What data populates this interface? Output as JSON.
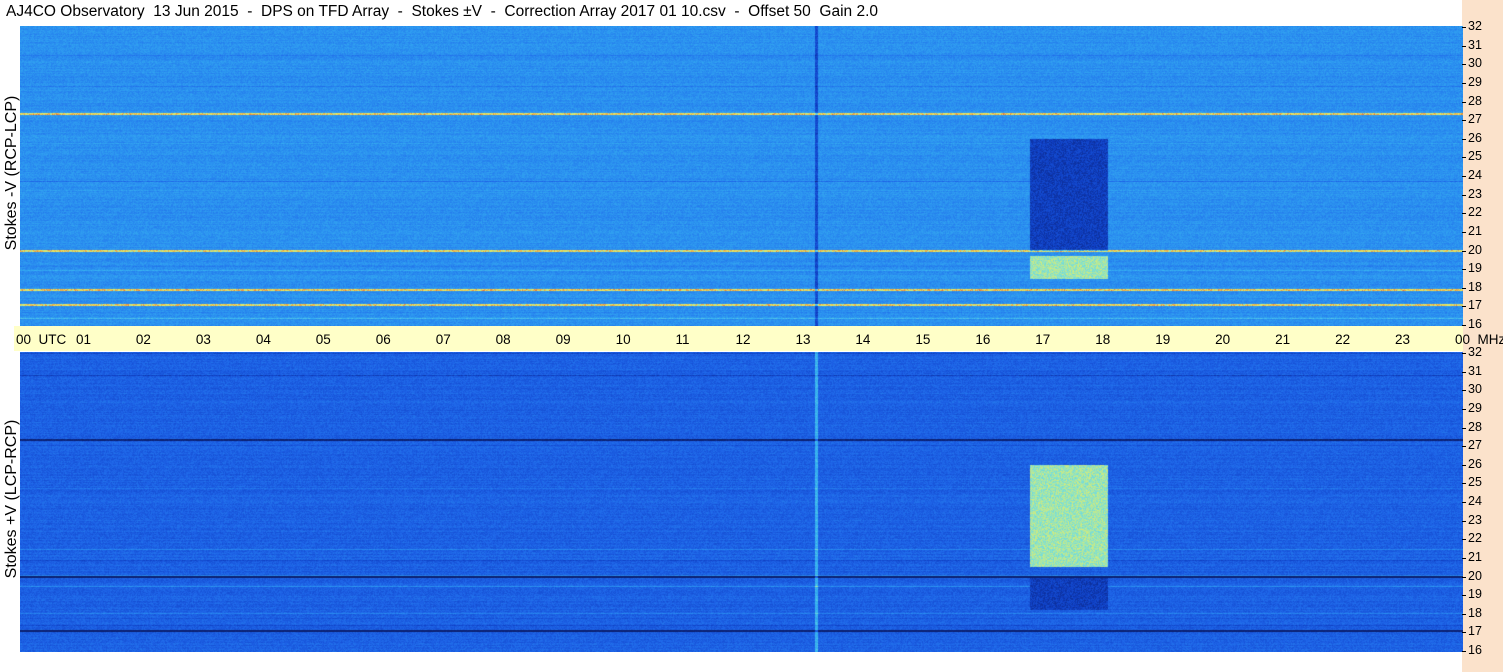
{
  "title": "AJ4CO Observatory  13 Jun 2015  -  DPS on TFD Array  -  Stokes ±V  -  Correction Array 2017 01 10.csv  -  Offset 50  Gain 2.0",
  "colors": {
    "timebar_bg": "#ffffc8",
    "right_strip_bg": "#fbe2cb",
    "colormap": [
      "#0b1f6e",
      "#0f3fc4",
      "#1e64e8",
      "#2a8ff0",
      "#39b7f0",
      "#7ee0d4",
      "#f2f05a",
      "#f59a3a",
      "#d83a2a"
    ]
  },
  "chart_data": [
    {
      "type": "heatmap",
      "panel": "top",
      "ylabel": "Stokes -V (RCP-LCP)",
      "x_unit": "UTC",
      "y_unit": "MHz",
      "xlim": [
        0,
        24
      ],
      "ylim": [
        16,
        32
      ],
      "x_ticks": [
        "00",
        "01",
        "02",
        "03",
        "04",
        "05",
        "06",
        "07",
        "08",
        "09",
        "10",
        "11",
        "12",
        "13",
        "14",
        "15",
        "16",
        "17",
        "18",
        "19",
        "20",
        "21",
        "22",
        "23",
        "00"
      ],
      "y_ticks": [
        "16",
        "17",
        "18",
        "19",
        "20",
        "21",
        "22",
        "23",
        "24",
        "25",
        "26",
        "27",
        "28",
        "29",
        "30",
        "31",
        "32"
      ],
      "features": [
        {
          "kind": "bright_band",
          "t_start": 16.8,
          "t_end": 18.1,
          "f_low": 18.5,
          "f_high": 19.7
        },
        {
          "kind": "dark_band",
          "t_start": 16.8,
          "t_end": 18.1,
          "f_low": 20.0,
          "f_high": 26.0
        },
        {
          "kind": "dark_vertical_line",
          "t": 13.25
        },
        {
          "kind": "bright_horizontal_line",
          "f": 17.1
        },
        {
          "kind": "bright_horizontal_line",
          "f": 17.9
        },
        {
          "kind": "bright_horizontal_line",
          "f": 20.0
        },
        {
          "kind": "bright_horizontal_line",
          "f": 27.3
        }
      ]
    },
    {
      "type": "heatmap",
      "panel": "bottom",
      "ylabel": "Stokes +V (LCP-RCP)",
      "x_unit": "UTC",
      "y_unit": "MHz",
      "xlim": [
        0,
        24
      ],
      "ylim": [
        16,
        32
      ],
      "x_ticks": [
        "00",
        "01",
        "02",
        "03",
        "04",
        "05",
        "06",
        "07",
        "08",
        "09",
        "10",
        "11",
        "12",
        "13",
        "14",
        "15",
        "16",
        "17",
        "18",
        "19",
        "20",
        "21",
        "22",
        "23",
        "00"
      ],
      "y_ticks": [
        "16",
        "17",
        "18",
        "19",
        "20",
        "21",
        "22",
        "23",
        "24",
        "25",
        "26",
        "27",
        "28",
        "29",
        "30",
        "31",
        "32"
      ],
      "features": [
        {
          "kind": "bright_band",
          "t_start": 16.8,
          "t_end": 18.1,
          "f_low": 20.5,
          "f_high": 26.0
        },
        {
          "kind": "dark_band",
          "t_start": 16.8,
          "t_end": 18.1,
          "f_low": 18.2,
          "f_high": 20.0
        },
        {
          "kind": "bright_vertical_line",
          "t": 13.25
        },
        {
          "kind": "dark_horizontal_line",
          "f": 17.1
        },
        {
          "kind": "dark_horizontal_line",
          "f": 20.0
        },
        {
          "kind": "dark_horizontal_line",
          "f": 27.3
        }
      ]
    }
  ],
  "time_axis": {
    "labels": [
      "00  UTC",
      "01",
      "02",
      "03",
      "04",
      "05",
      "06",
      "07",
      "08",
      "09",
      "10",
      "11",
      "12",
      "13",
      "14",
      "15",
      "16",
      "17",
      "18",
      "19",
      "20",
      "21",
      "22",
      "23",
      "00  MHz"
    ]
  }
}
